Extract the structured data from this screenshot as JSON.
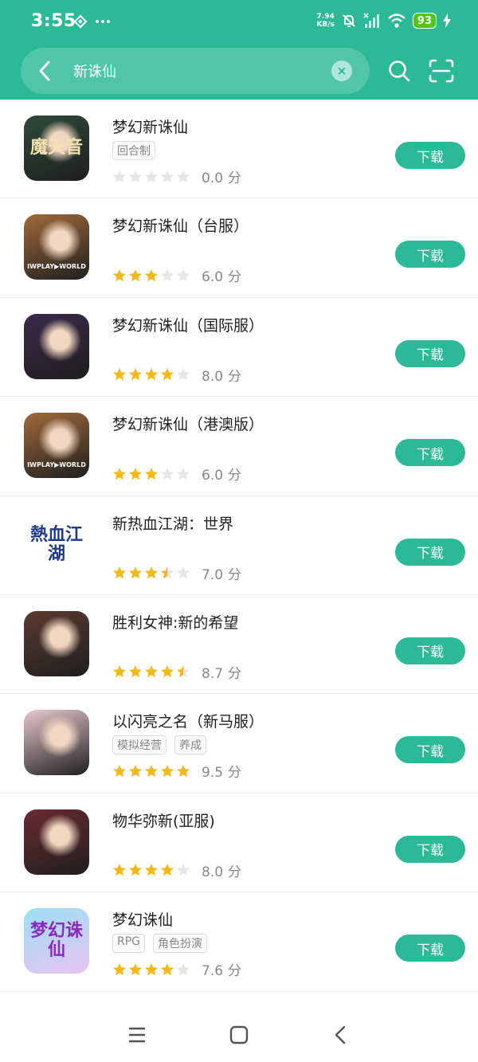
{
  "status_bar": {
    "time": "3:55",
    "net_speed_value": "7.94",
    "net_speed_unit": "KB/s",
    "battery": "93"
  },
  "search": {
    "query": "新诛仙",
    "clear_icon": "×"
  },
  "colors": {
    "accent": "#2bb998",
    "star_on": "#f5b81b",
    "star_off": "#e6e6e6"
  },
  "download_label": "下载",
  "score_unit": "分",
  "apps": [
    {
      "name": "梦幻新诛仙",
      "tags": [
        "回合制"
      ],
      "rating": 0.0,
      "score": "0.0",
      "icon_text": "魔天音",
      "icon_bg": "#2e4a3a",
      "icon_fg": "#f3e0b0"
    },
    {
      "name": "梦幻新诛仙（台服）",
      "tags": [],
      "rating": 3.0,
      "score": "6.0",
      "icon_text": "IWPLAY▶WORLD",
      "icon_bg": "#a06a3a",
      "icon_fg": "#ffffff"
    },
    {
      "name": "梦幻新诛仙（国际服）",
      "tags": [],
      "rating": 4.0,
      "score": "8.0",
      "icon_text": "",
      "icon_bg": "#3a2a4a",
      "icon_fg": "#ffffff"
    },
    {
      "name": "梦幻新诛仙（港澳版）",
      "tags": [],
      "rating": 3.0,
      "score": "6.0",
      "icon_text": "IWPLAY▶WORLD",
      "icon_bg": "#a06a3a",
      "icon_fg": "#ffffff"
    },
    {
      "name": "新热血江湖：世界",
      "tags": [],
      "rating": 3.5,
      "score": "7.0",
      "icon_text": "熱血江湖",
      "icon_bg": "#ffffff",
      "icon_fg": "#1e3b8a"
    },
    {
      "name": "胜利女神:新的希望",
      "tags": [],
      "rating": 4.5,
      "score": "8.7",
      "icon_text": "",
      "icon_bg": "#5a3a30",
      "icon_fg": "#ffffff"
    },
    {
      "name": "以闪亮之名（新马服）",
      "tags": [
        "模拟经营",
        "养成"
      ],
      "rating": 5.0,
      "score": "9.5",
      "icon_text": "",
      "icon_bg": "#e8c8cf",
      "icon_fg": "#ffffff"
    },
    {
      "name": "物华弥新(亚服)",
      "tags": [],
      "rating": 4.0,
      "score": "8.0",
      "icon_text": "",
      "icon_bg": "#6a2a30",
      "icon_fg": "#ffffff"
    },
    {
      "name": "梦幻诛仙",
      "tags": [
        "RPG",
        "角色扮演"
      ],
      "rating": 4.0,
      "score": "7.6",
      "icon_text": "梦幻诛仙",
      "icon_bg": "#8fd3f0",
      "icon_fg": "#8a2ac0"
    }
  ]
}
